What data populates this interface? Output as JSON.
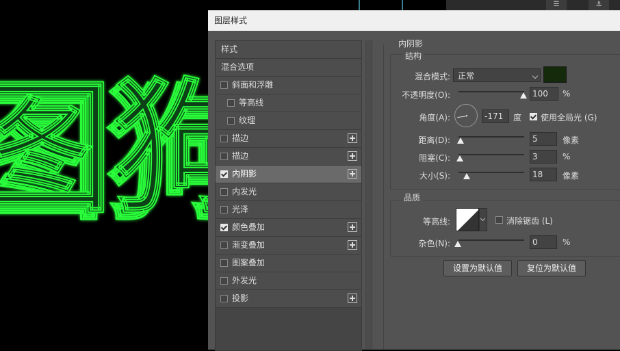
{
  "canvas": {
    "art_text": "图狗",
    "colors": {
      "glow": "#2aff3a",
      "dark": "#0a3a10"
    }
  },
  "toolbar": {
    "icons": [
      "list-light-icon",
      "anchor-icon"
    ]
  },
  "dialog": {
    "title": "图层样式",
    "styles": [
      {
        "label": "样式",
        "kind": "header"
      },
      {
        "label": "混合选项",
        "kind": "blend"
      },
      {
        "label": "斜面和浮雕",
        "checked": false,
        "plus": false
      },
      {
        "label": "等高线",
        "checked": false,
        "sub": true
      },
      {
        "label": "纹理",
        "checked": false,
        "sub": true
      },
      {
        "label": "描边",
        "checked": false,
        "plus": true
      },
      {
        "label": "描边",
        "checked": false,
        "plus": true
      },
      {
        "label": "内阴影",
        "checked": true,
        "plus": true,
        "selected": true
      },
      {
        "label": "内发光",
        "checked": false,
        "plus": false
      },
      {
        "label": "光泽",
        "checked": false,
        "plus": false
      },
      {
        "label": "颜色叠加",
        "checked": true,
        "plus": true
      },
      {
        "label": "渐变叠加",
        "checked": false,
        "plus": true
      },
      {
        "label": "图案叠加",
        "checked": false,
        "plus": false
      },
      {
        "label": "外发光",
        "checked": false,
        "plus": false
      },
      {
        "label": "投影",
        "checked": false,
        "plus": true
      }
    ],
    "inner_shadow": {
      "title": "内阴影",
      "structure": {
        "title": "结构",
        "blend_mode_label": "混合模式:",
        "blend_mode_value": "正常",
        "color": "#142a0a",
        "opacity_label": "不透明度(O):",
        "opacity_value": "100",
        "opacity_unit": "%",
        "opacity_level": 1.0,
        "angle_label": "角度(A):",
        "angle_value": "-171",
        "angle_unit": "度",
        "global_light_label": "使用全局光 (G)",
        "global_light_checked": true,
        "distance_label": "距离(D):",
        "distance_value": "5",
        "distance_unit": "像素",
        "choke_label": "阻塞(C):",
        "choke_value": "3",
        "choke_unit": "%",
        "size_label": "大小(S):",
        "size_value": "18",
        "size_unit": "像素"
      },
      "quality": {
        "title": "品质",
        "contour_label": "等高线:",
        "anti_alias_label": "消除锯齿 (L)",
        "anti_alias_checked": false,
        "noise_label": "杂色(N):",
        "noise_value": "0",
        "noise_unit": "%"
      },
      "buttons": {
        "make_default": "设置为默认值",
        "reset_default": "复位为默认值"
      }
    }
  }
}
